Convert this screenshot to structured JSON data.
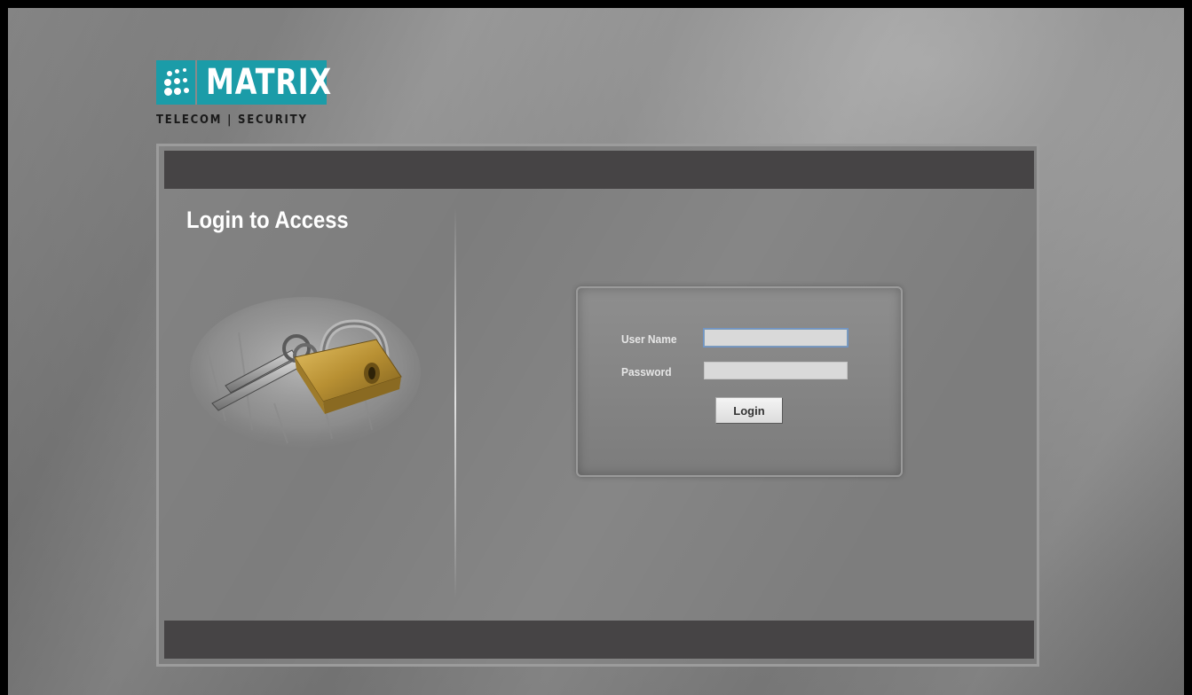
{
  "logo": {
    "wordmark": "MATRIX",
    "tagline": "TELECOM | SECURITY",
    "brand_color": "#1b9ca8"
  },
  "panel": {
    "title": "Login to Access",
    "illustration": "padlock-with-keys-on-keyboard"
  },
  "login_form": {
    "username_label": "User Name",
    "username_value": "",
    "password_label": "Password",
    "password_value": "",
    "submit_label": "Login"
  },
  "colors": {
    "background": "#7d7d7d",
    "header_bar": "#464445",
    "text_light": "#ffffff"
  }
}
